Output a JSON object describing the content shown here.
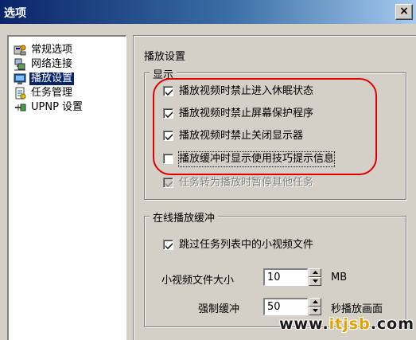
{
  "window": {
    "title": "选项",
    "close_symbol": "×"
  },
  "sidebar": {
    "items": [
      {
        "label": "常规选项",
        "icon": "general-options-icon",
        "selected": false
      },
      {
        "label": "网络连接",
        "icon": "network-connection-icon",
        "selected": false
      },
      {
        "label": "播放设置",
        "icon": "playback-settings-icon",
        "selected": true
      },
      {
        "label": "任务管理",
        "icon": "task-management-icon",
        "selected": false
      },
      {
        "label": "UPNP 设置",
        "icon": "upnp-settings-icon",
        "selected": false
      }
    ]
  },
  "main": {
    "section_title": "播放设置",
    "display_group": {
      "legend": "显示",
      "options": [
        {
          "label": "播放视频时禁止进入休眠状态",
          "checked": true,
          "enabled": true
        },
        {
          "label": "播放视频时禁止屏幕保护程序",
          "checked": true,
          "enabled": true
        },
        {
          "label": "播放视频时禁止关闭显示器",
          "checked": true,
          "enabled": true
        },
        {
          "label": "播放缓冲时显示使用技巧提示信息",
          "checked": false,
          "enabled": true
        },
        {
          "label": "任务转为播放时暂停其他任务",
          "checked": true,
          "enabled": false
        }
      ]
    },
    "buffer_group": {
      "legend": "在线播放缓冲",
      "skip_small": {
        "label": "跳过任务列表中的小视频文件",
        "checked": true
      },
      "small_size": {
        "label": "小视频文件大小",
        "value": "10",
        "unit": "MB"
      },
      "force_buffer": {
        "label": "强制缓冲",
        "value": "50",
        "unit": "秒播放画面"
      }
    }
  },
  "watermark": {
    "prefix": "www.",
    "accent": "itjsb",
    "suffix": ".com"
  },
  "colors": {
    "titlebar_start": "#0a246a",
    "titlebar_end": "#a6caf0",
    "selection": "#0a246a",
    "highlight": "#e00000",
    "watermark_accent": "#e8a000"
  }
}
